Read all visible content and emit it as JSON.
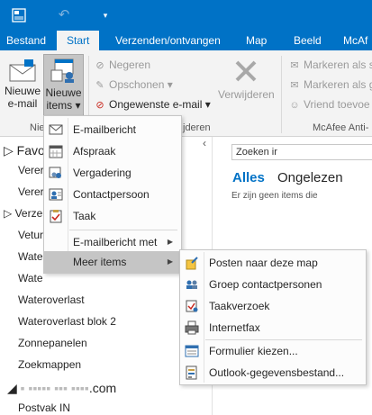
{
  "titlebar": {
    "app_icon": "outlook-app-icon",
    "undo_icon": "undo-icon",
    "qa_icon": "quick-access-customize-icon"
  },
  "tabs": [
    {
      "label": "Bestand"
    },
    {
      "label": "Start"
    },
    {
      "label": "Verzenden/ontvangen"
    },
    {
      "label": "Map"
    },
    {
      "label": "Beeld"
    },
    {
      "label": "McAf"
    }
  ],
  "ribbon": {
    "nieuwe_email": {
      "line1": "Nieuwe",
      "line2": "e-mail"
    },
    "nieuwe_items": {
      "line1": "Nieuwe",
      "line2": "items ▾"
    },
    "negeren": "Negeren",
    "opschonen": "Opschonen ▾",
    "ongewenste": "Ongewenste e-mail ▾",
    "verwijderen": "Verwijderen",
    "markeren1": "Markeren als s",
    "markeren2": "Markeren als g",
    "vriend": "Vriend toevoe",
    "group_nieuw": "Nie",
    "group_verwijderen": "jderen",
    "group_mcafee": "McAfee Anti-"
  },
  "folders": {
    "fav": "Favo",
    "items": [
      "Verer",
      "Verer",
      "Verze",
      "Vetur",
      "Wate",
      "Wate",
      "Wateroverlast",
      "Wateroverlast blok 2",
      "Zonnepanelen",
      "Zoekmappen"
    ],
    "account": ".com",
    "account_sub": "Postvak IN"
  },
  "maillist": {
    "search_placeholder": "Zoeken ir",
    "filter_all": "Alles",
    "filter_unread": "Ongelezen",
    "empty": "Er zijn geen items die"
  },
  "menu_main": [
    {
      "label": "E-mailbericht",
      "icon": "envelope-icon"
    },
    {
      "label": "Afspraak",
      "icon": "calendar-icon"
    },
    {
      "label": "Vergadering",
      "icon": "meeting-icon"
    },
    {
      "label": "Contactpersoon",
      "icon": "contact-card-icon"
    },
    {
      "label": "Taak",
      "icon": "task-clipboard-icon"
    },
    {
      "label": "E-mailbericht met",
      "icon": "none"
    },
    {
      "label": "Meer items",
      "icon": "none"
    }
  ],
  "menu_sub": [
    {
      "label": "Posten naar deze map",
      "icon": "post-note-icon"
    },
    {
      "label": "Groep contactpersonen",
      "icon": "contact-group-icon"
    },
    {
      "label": "Taakverzoek",
      "icon": "task-request-icon"
    },
    {
      "label": "Internetfax",
      "icon": "fax-icon"
    },
    {
      "label": "Formulier kiezen...",
      "icon": "form-icon"
    },
    {
      "label": "Outlook-gegevensbestand...",
      "icon": "data-file-icon"
    }
  ],
  "colors": {
    "accent": "#0072c6",
    "ribbon_bg": "#f3f3f3",
    "highlight": "#c5c5c5"
  }
}
